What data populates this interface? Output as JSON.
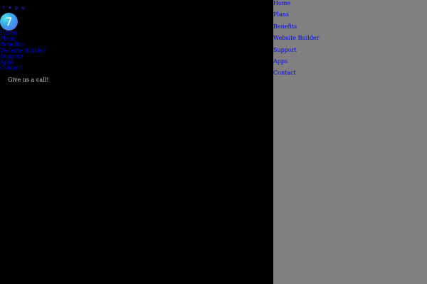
{
  "social": [
    {
      "icon": "facebook-icon",
      "glyph": "f"
    },
    {
      "icon": "twitter-icon",
      "glyph": "✦"
    },
    {
      "icon": "pinterest-icon",
      "glyph": "p"
    },
    {
      "icon": "instagram-icon",
      "glyph": "◎"
    }
  ],
  "logo": {
    "text": "7"
  },
  "nav_small": [
    "Home",
    "Plans",
    "Benefits",
    "Website Builder",
    "Support",
    "Apps",
    "Contact"
  ],
  "call": {
    "text": "Give us a call!"
  },
  "nav_big": [
    "Home",
    "Plans",
    "Benefits",
    "Website Builder",
    "Support",
    "Apps",
    "Contact"
  ],
  "colors": {
    "left_bg": "#000000",
    "right_bg": "#808080",
    "link": "#0000ee"
  }
}
